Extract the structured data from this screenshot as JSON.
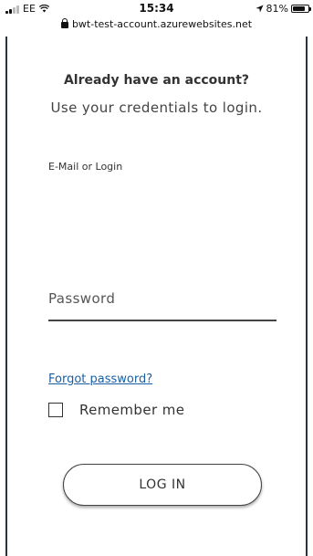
{
  "status_bar": {
    "carrier": "EE",
    "time": "15:34",
    "battery": "81%",
    "battery_level": 0.81
  },
  "url_bar": {
    "url": "bwt-test-account.azurewebsites.net"
  },
  "login": {
    "title": "Already have an account?",
    "subtitle": "Use your credentials to login.",
    "email_label": "E-Mail or Login",
    "email_value": "",
    "password_placeholder": "Password",
    "forgot_password": "Forgot password?",
    "remember_me": "Remember me",
    "remember_checked": false,
    "login_button": "LOG IN"
  },
  "colors": {
    "link": "#1a5fa3",
    "frame": "#2b3140"
  }
}
